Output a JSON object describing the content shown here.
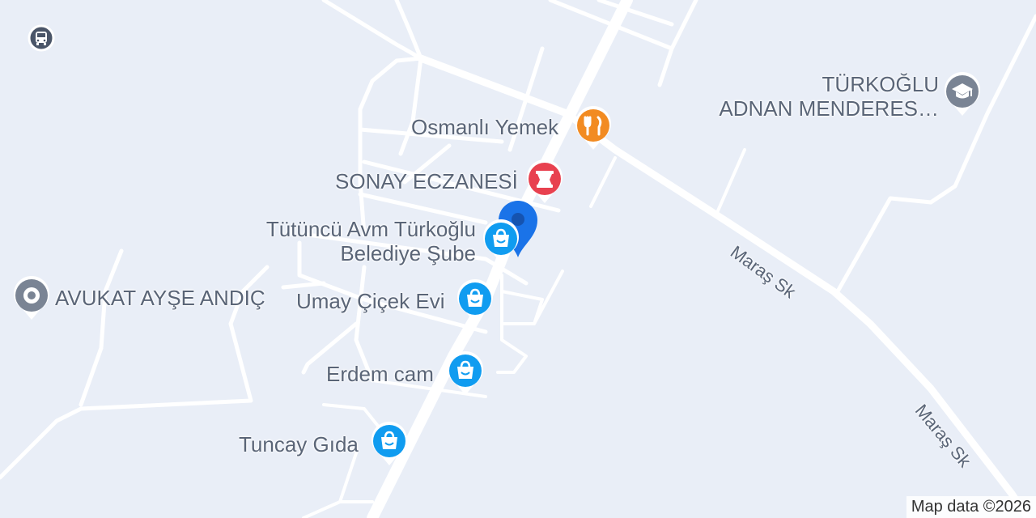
{
  "map": {
    "places": {
      "restaurant": {
        "name": "Osmanlı Yemek",
        "icon": "fork-knife-icon",
        "color": "#f28b22"
      },
      "pharmacy": {
        "name": "SONAY ECZANESİ",
        "icon": "mortar-pestle-icon",
        "color": "#e8414f"
      },
      "mall": {
        "name": "Tütüncü Avm Türkoğlu\nBelediye Şube",
        "icon": "shopping-bag-icon",
        "color": "#109cf0"
      },
      "lawyer": {
        "name": "AVUKAT AYŞE ANDIÇ",
        "icon": "place-icon",
        "color": "#7a8494"
      },
      "flowers": {
        "name": "Umay Çiçek Evi",
        "icon": "shopping-bag-icon",
        "color": "#109cf0"
      },
      "glass": {
        "name": "Erdem cam",
        "icon": "shopping-bag-icon",
        "color": "#109cf0"
      },
      "grocery": {
        "name": "Tuncay Gıda",
        "icon": "shopping-bag-icon",
        "color": "#109cf0"
      },
      "school": {
        "name": "TÜRKOĞLU\nADNAN MENDERES…",
        "icon": "graduation-cap-icon",
        "color": "#7a8494"
      },
      "bus": {
        "icon": "bus-icon",
        "color": "#4a5568"
      }
    },
    "streets": {
      "s1": "Maraş Sk",
      "s2": "Maraş Sk"
    },
    "marker": {
      "icon": "location-marker-icon",
      "color": "#1a73e8"
    },
    "attribution": "Map data ©2026"
  }
}
